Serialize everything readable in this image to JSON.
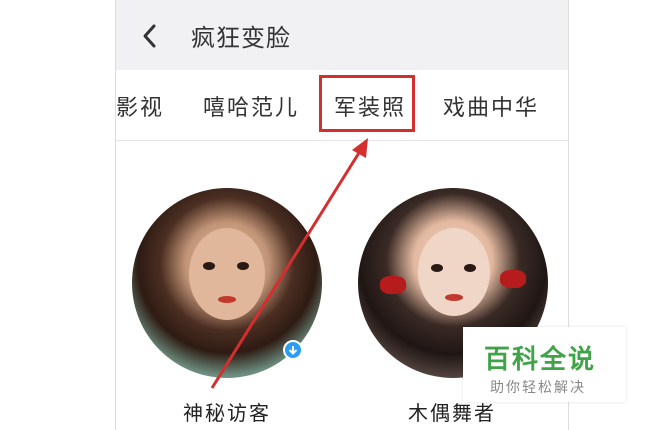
{
  "header": {
    "title": "疯狂变脸",
    "back_icon": "chevron-left-icon"
  },
  "tabs": [
    {
      "label": "影视"
    },
    {
      "label": "嘻哈范儿"
    },
    {
      "label": "军装照"
    },
    {
      "label": "戏曲中华"
    }
  ],
  "annotation": {
    "highlighted_tab": "军装照",
    "color": "#d32f2f"
  },
  "cards": [
    {
      "name": "神秘访客",
      "badge_icon": "download-icon"
    },
    {
      "name": "木偶舞者"
    }
  ],
  "watermark": {
    "title": "百科全说",
    "subtitle": "助你轻松解决",
    "color": "#3fa448"
  },
  "colors": {
    "header_bg": "#f1f1f3",
    "badge": "#2a9df4"
  }
}
